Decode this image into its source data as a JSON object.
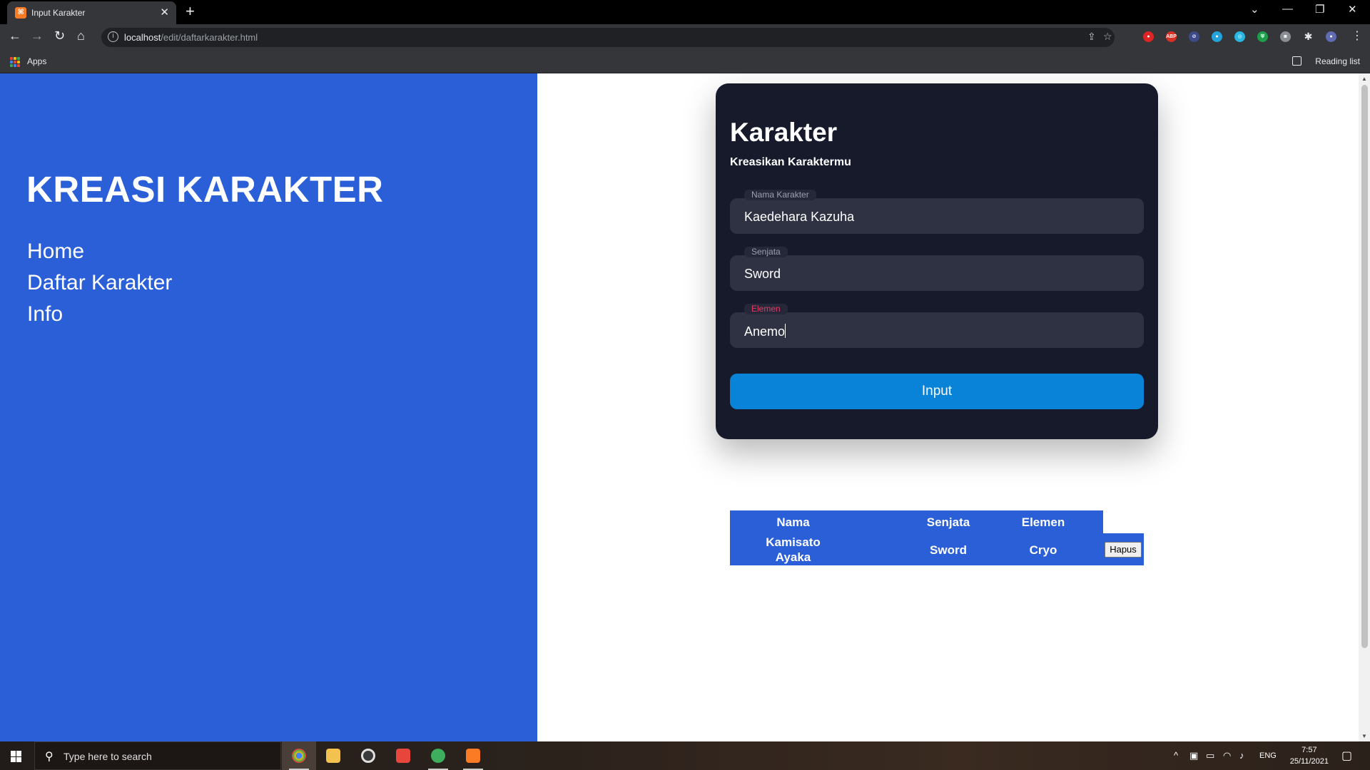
{
  "browser": {
    "tab_title": "Input Karakter",
    "tab_favicon": "xampp-icon",
    "new_tab": "+",
    "url_host": "localhost",
    "url_path": "/edit/daftarkarakter.html",
    "bookmarks_apps": "Apps",
    "reading_list": "Reading list",
    "extensions": [
      "ABP"
    ]
  },
  "sidebar": {
    "title": "KREASI KARAKTER",
    "nav": [
      "Home",
      "Daftar Karakter",
      "Info"
    ]
  },
  "form": {
    "title": "Karakter",
    "subtitle": "Kreasikan Karaktermu",
    "fields": [
      {
        "label": "Nama Karakter",
        "value": "Kaedehara Kazuha"
      },
      {
        "label": "Senjata",
        "value": "Sword"
      },
      {
        "label": "Elemen",
        "value": "Anemo"
      }
    ],
    "submit": "Input"
  },
  "table": {
    "headers": [
      "Nama",
      "Senjata",
      "Elemen"
    ],
    "rows": [
      {
        "nama_line1": "Kamisato",
        "nama_line2": "Ayaka",
        "senjata": "Sword",
        "elemen": "Cryo",
        "action": "Hapus"
      }
    ]
  },
  "taskbar": {
    "search_placeholder": "Type here to search",
    "language": "ENG",
    "time": "7:57",
    "date": "25/11/2021"
  },
  "colors": {
    "sidebar_bg": "#2a5fd8",
    "card_bg": "#161a2b",
    "field_bg": "#2f3242",
    "button_bg": "#0883d8",
    "active_label": "#e33a66"
  }
}
